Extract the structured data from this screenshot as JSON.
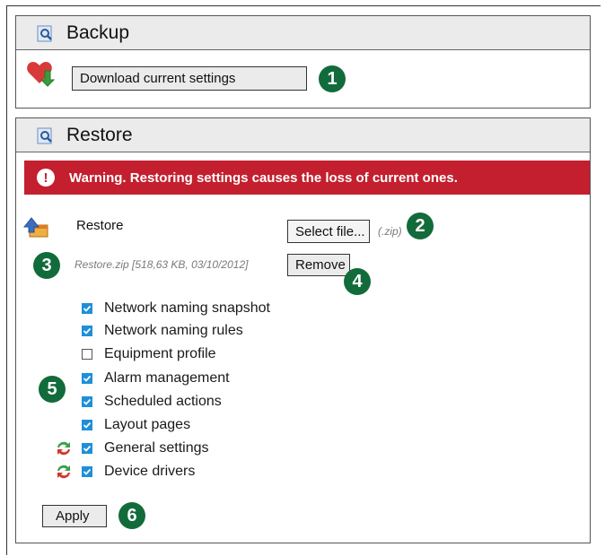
{
  "backup": {
    "title": "Backup",
    "download_label": "Download current settings",
    "badge": "1"
  },
  "restore": {
    "title": "Restore",
    "warning": "Warning. Restoring settings causes the loss of current ones.",
    "restore_label": "Restore",
    "select_file_label": "Select file...",
    "file_ext_hint": "(.zip)",
    "file_info": "Restore.zip [518,63 KB, 03/10/2012]",
    "remove_label": "Remove",
    "apply_label": "Apply",
    "badges": [
      "2",
      "3",
      "4",
      "5",
      "6"
    ],
    "options": [
      {
        "label": "Network naming snapshot",
        "checked": true
      },
      {
        "label": "Network naming rules",
        "checked": true
      },
      {
        "label": "Equipment profile",
        "checked": false
      },
      {
        "label": "Alarm management",
        "checked": true
      },
      {
        "label": "Scheduled actions",
        "checked": true
      },
      {
        "label": "Layout pages",
        "checked": true
      },
      {
        "label": "General settings",
        "checked": true
      },
      {
        "label": "Device drivers",
        "checked": true
      }
    ]
  },
  "colors": {
    "accent_green": "#126b3a",
    "warning_red": "#c41f2f",
    "checkbox_blue": "#1e8fd8",
    "header_bg": "#ebebeb"
  }
}
